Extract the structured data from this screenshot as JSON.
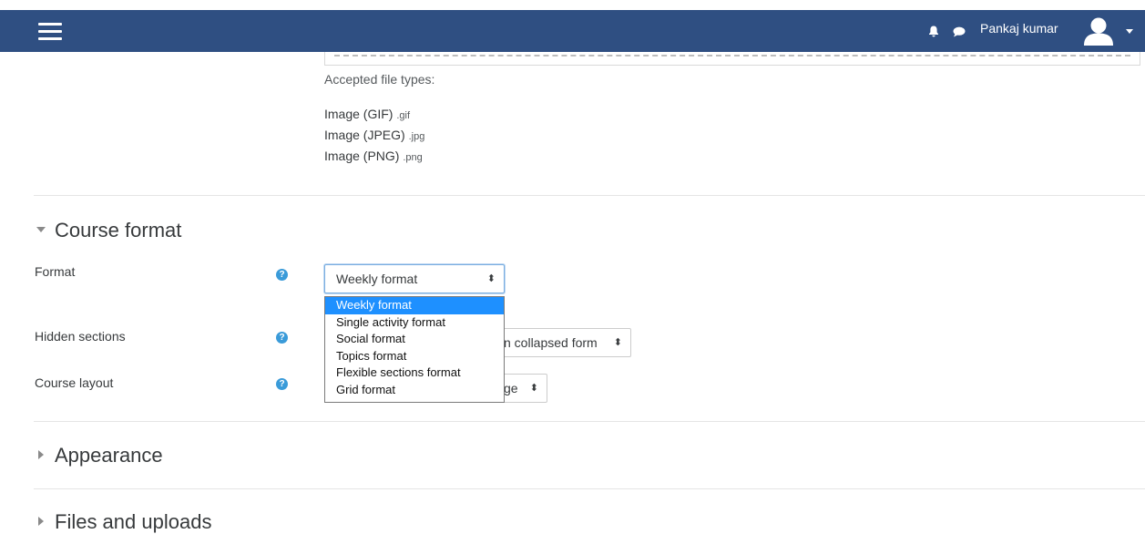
{
  "navbar": {
    "username": "Pankaj kumar",
    "icons": [
      "menu-icon",
      "bell-icon",
      "chat-icon",
      "user-avatar-icon",
      "caret-down-icon"
    ]
  },
  "files": {
    "accepted_label": "Accepted file types:",
    "types": [
      {
        "name": "Image (GIF)",
        "ext": ".gif"
      },
      {
        "name": "Image (JPEG)",
        "ext": ".jpg"
      },
      {
        "name": "Image (PNG)",
        "ext": ".png"
      }
    ]
  },
  "course_format": {
    "title": "Course format",
    "format_label": "Format",
    "format_value": "Weekly format",
    "hidden_label": "Hidden sections",
    "hidden_value_visible": "n collapsed form",
    "layout_label": "Course layout",
    "layout_value_visible": "ge",
    "options": [
      "Weekly format",
      "Single activity format",
      "Social format",
      "Topics format",
      "Flexible sections format",
      "Grid format"
    ],
    "selected_option": "Weekly format"
  },
  "sections": {
    "appearance": "Appearance",
    "files_uploads": "Files and uploads"
  },
  "colors": {
    "navbar": "#2f4f82",
    "selection": "#1e90ff",
    "help_icon": "#3a9bd9"
  }
}
